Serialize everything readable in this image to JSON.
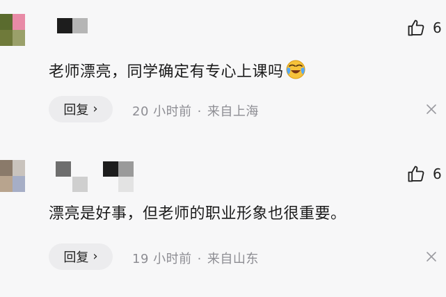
{
  "comments": [
    {
      "like_count": "6",
      "text": "老师漂亮，同学确定有专心上课吗",
      "emoji": "crying-laughing",
      "reply_label": "回复",
      "chevron": "›",
      "time": "20 小时前",
      "separator": "·",
      "location": "来自上海"
    },
    {
      "like_count": "6",
      "text": "漂亮是好事，但老师的职业形象也很重要。",
      "reply_label": "回复",
      "chevron": "›",
      "time": "19 小时前",
      "separator": "·",
      "location": "来自山东"
    }
  ],
  "colors": {
    "background": "#f7f7f8",
    "meta_text": "#8d8d93",
    "reply_bg": "#ececee"
  }
}
